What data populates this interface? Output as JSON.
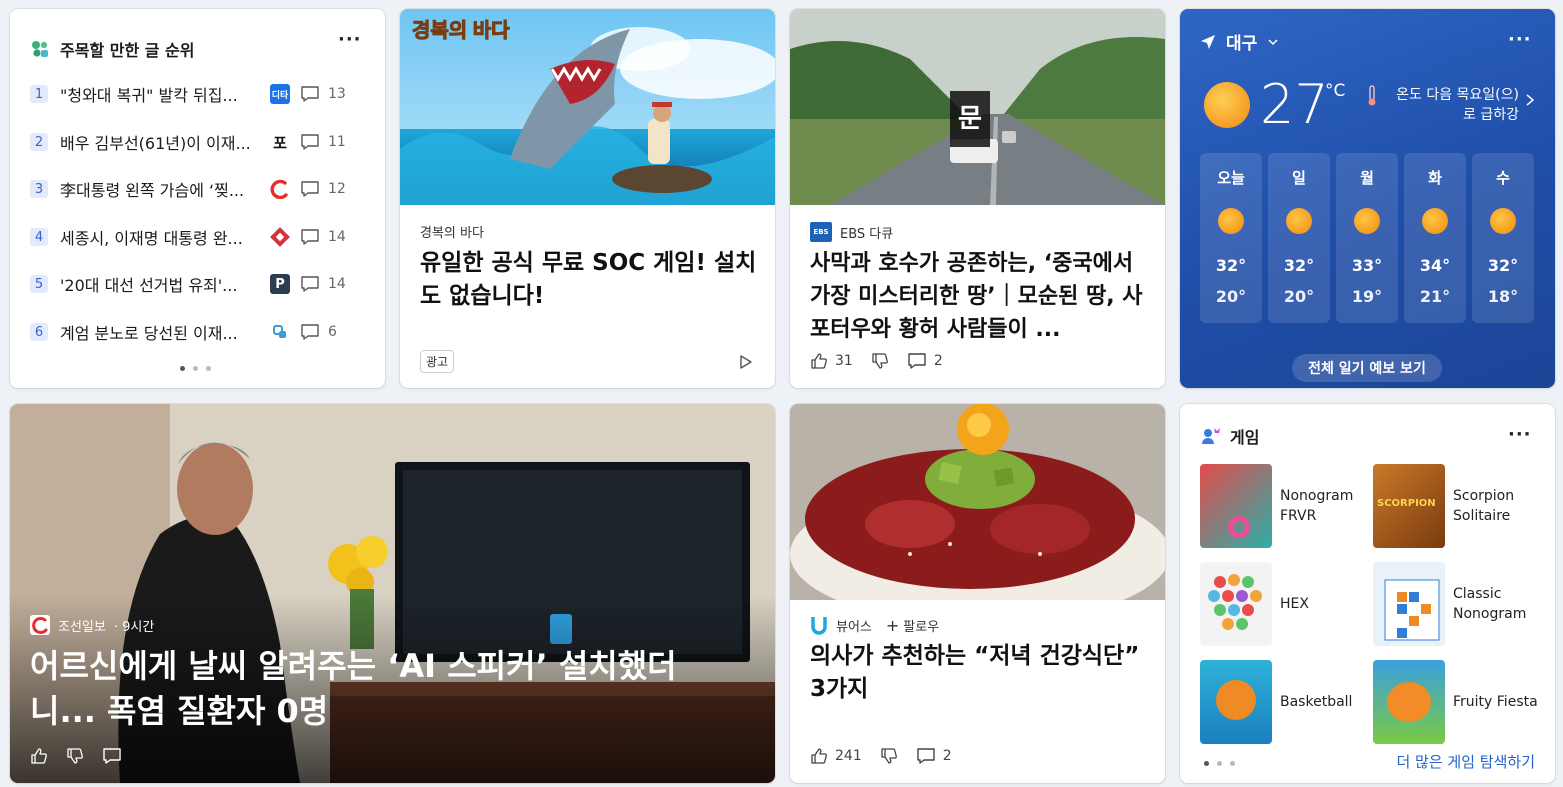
{
  "trending": {
    "title": "주목할 만한 글 순위",
    "menu": "···",
    "items": [
      {
        "rank": "1",
        "text": "\"청와대 복귀\" 발칵 뒤집...",
        "source_label": "디타",
        "comments": "13",
        "color": "#1a73e8"
      },
      {
        "rank": "2",
        "text": "배우 김부선(61년)이 이재...",
        "source_label": "포",
        "comments": "11",
        "color": "#111111"
      },
      {
        "rank": "3",
        "text": "李대통령 왼쪽 가슴에 ‘찢...",
        "source_label": "",
        "comments": "12",
        "color": "#e52d2d"
      },
      {
        "rank": "4",
        "text": "세종시, 이재명 대통령 완...",
        "source_label": "",
        "comments": "14",
        "color": "#d6323a"
      },
      {
        "rank": "5",
        "text": "'20대 대선 선거법 유죄'...",
        "source_label": "P",
        "comments": "14",
        "color": "#2e3c4f"
      },
      {
        "rank": "6",
        "text": "계엄 분노로 당선된 이재...",
        "source_label": "",
        "comments": "6",
        "color": "#3a9be0"
      }
    ]
  },
  "ad_card": {
    "image_text": "경복의 바다",
    "source": "경복의 바다",
    "headline": "유일한 공식 무료 SOC 게임! 설치도 없습니다!",
    "badge": "광고"
  },
  "ebs_card": {
    "source_logo": "EBS",
    "source": "EBS 다큐",
    "headline": "사막과 호수가 공존하는, ‘중국에서 가장 미스터리한 땅’｜모순된 땅, 사포터우와 황허 사람들이 ...",
    "likes": "31",
    "comments": "2"
  },
  "weather": {
    "location": "대구",
    "temp": "27",
    "unit": "°C",
    "alert": "온도 다음 목요일(으)로 급하강",
    "days": [
      {
        "day": "오늘",
        "hi": "32°",
        "lo": "20°"
      },
      {
        "day": "일",
        "hi": "32°",
        "lo": "20°"
      },
      {
        "day": "월",
        "hi": "33°",
        "lo": "19°"
      },
      {
        "day": "화",
        "hi": "34°",
        "lo": "21°"
      },
      {
        "day": "수",
        "hi": "32°",
        "lo": "18°"
      }
    ],
    "forecast_button": "전체 일기 예보 보기",
    "menu": "···"
  },
  "big_card": {
    "source": "조선일보",
    "time": "· 9시간",
    "headline": "어르신에게 날씨 알려주는 ‘AI 스피커’ 설치했더니... 폭염 질환자 0명"
  },
  "food_card": {
    "source": "뷰어스",
    "follow": "팔로우",
    "headline": "의사가 추천하는 “저녁 건강식단” 3가지",
    "likes": "241",
    "comments": "2"
  },
  "games": {
    "title": "게임",
    "menu": "···",
    "items": [
      {
        "name": "Nonogram FRVR",
        "color": "#d94b4b"
      },
      {
        "name": "Scorpion Solitaire",
        "color": "#b5651d"
      },
      {
        "name": "HEX",
        "color": "#e8e8e8"
      },
      {
        "name": "Classic Nonogram",
        "color": "#2f7fd8"
      },
      {
        "name": "Basketball",
        "color": "#2fa0c8"
      },
      {
        "name": "Fruity Fiesta",
        "color": "#3aa0e0"
      }
    ],
    "more_link": "더 많은 게임 탐색하기"
  }
}
